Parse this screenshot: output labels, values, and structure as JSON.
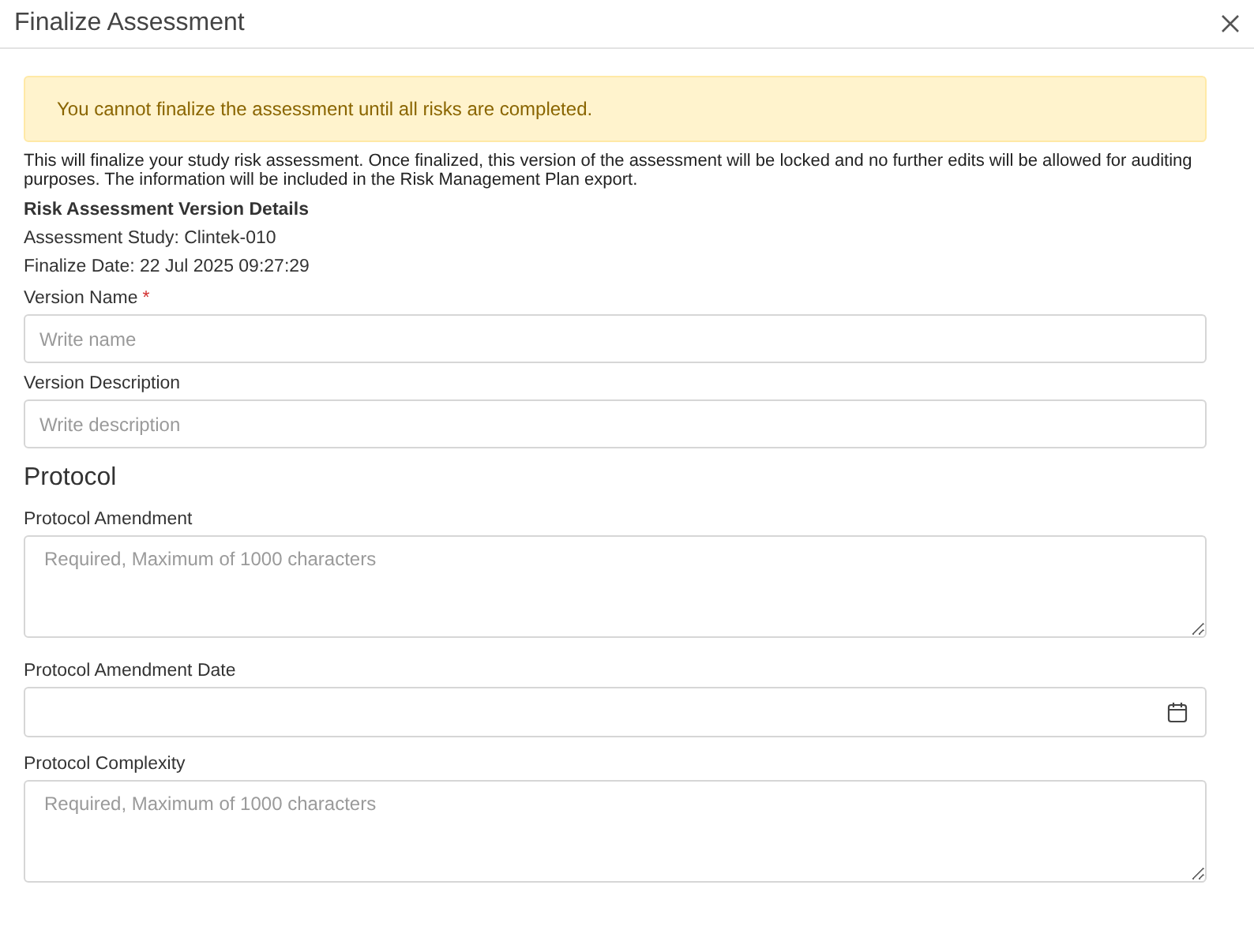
{
  "dialog": {
    "title": "Finalize Assessment"
  },
  "alert": {
    "message": "You cannot finalize the assessment until all risks are completed."
  },
  "intro": "This will finalize your study risk assessment. Once finalized, this version of the assessment will be locked and no further edits will be allowed for auditing purposes. The information will be included in the Risk Management Plan export.",
  "details": {
    "heading": "Risk Assessment Version Details",
    "lines": [
      "Assessment Study: Clintek-010",
      "Finalize Date: 22 Jul 2025 09:27:29"
    ]
  },
  "form": [
    {
      "kind": "input",
      "label": "Version Name",
      "required_mark": "*",
      "placeholder": "Write name"
    },
    {
      "kind": "input",
      "label": "Version Description",
      "placeholder": "Write description"
    },
    {
      "kind": "heading",
      "label": "Protocol"
    },
    {
      "kind": "textarea",
      "label": "Protocol Amendment",
      "placeholder": "Required, Maximum of 1000 characters"
    },
    {
      "kind": "date",
      "label": "Protocol Amendment Date"
    },
    {
      "kind": "textarea",
      "label": "Protocol Complexity",
      "placeholder": "Required, Maximum of 1000 characters"
    }
  ]
}
